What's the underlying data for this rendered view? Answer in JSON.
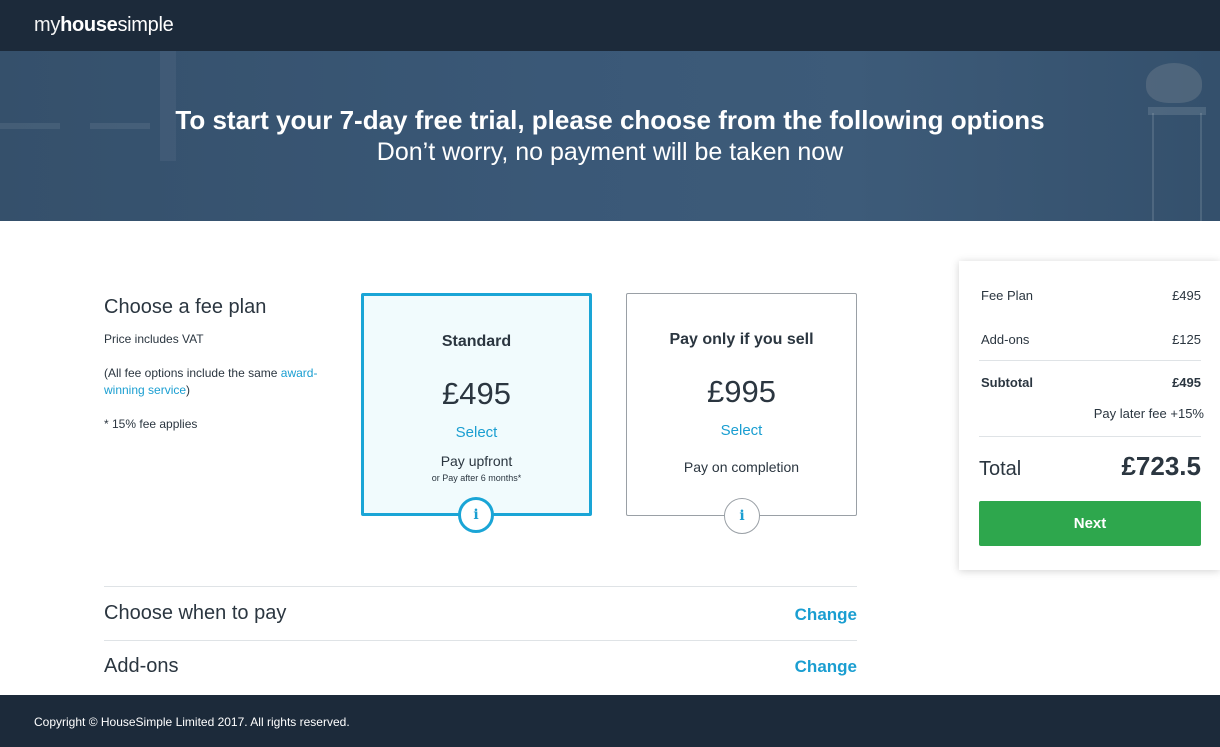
{
  "header": {
    "logo_my": "my",
    "logo_house": "house",
    "logo_simple": "simple"
  },
  "hero": {
    "title": "To start your 7-day free trial, please choose from the following options",
    "subtitle": "Don’t worry, no payment will be taken now"
  },
  "fee_plan": {
    "heading": "Choose a fee plan",
    "vat_note": "Price includes VAT",
    "options_note_prefix": "(All fee options include the same ",
    "options_note_link": "award-winning service",
    "options_note_suffix": ")",
    "fee_note": "* 15% fee applies",
    "plans": [
      {
        "name": "Standard",
        "price": "£495",
        "select": "Select",
        "desc": "Pay upfront",
        "note": "or Pay after 6 months*",
        "selected": true,
        "info": "i"
      },
      {
        "name": "Pay only if you sell",
        "price": "£995",
        "select": "Select",
        "desc": "Pay on completion",
        "selected": false,
        "info": "i"
      }
    ]
  },
  "sections": [
    {
      "label": "Choose when to pay",
      "action": "Change"
    },
    {
      "label": "Add-ons",
      "action": "Change"
    }
  ],
  "summary": {
    "fee_plan_label": "Fee Plan",
    "fee_plan_value": "£495",
    "addons_label": "Add-ons",
    "addons_value": "£125",
    "subtotal_label": "Subtotal",
    "subtotal_value": "£495",
    "pay_later_label": "Pay later fee",
    "pay_later_value": "+15%",
    "total_label": "Total",
    "total_value": "£723.5",
    "next_label": "Next"
  },
  "footer": {
    "copyright": "Copyright © HouseSimple Limited 2017. All rights reserved."
  },
  "colors": {
    "accent": "#1aa5d6",
    "link": "#1a9ed1",
    "cta": "#2ea74d",
    "dark": "#1c2a3a"
  }
}
